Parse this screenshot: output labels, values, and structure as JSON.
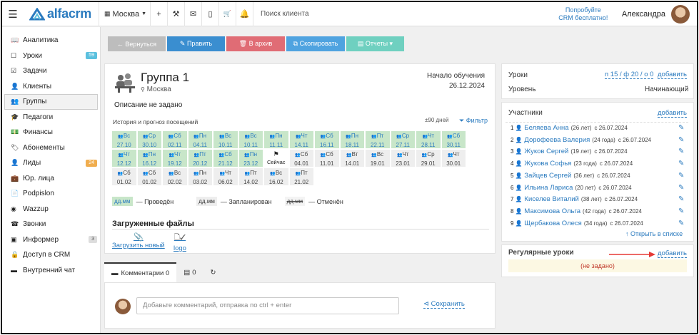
{
  "topbar": {
    "search_placeholder": "Поиск клиента",
    "branch": "Москва",
    "promo": [
      "Попробуйте",
      "CRM бесплатно!"
    ],
    "user_name": "Александра",
    "logo": "alfacrm"
  },
  "sidebar": {
    "items": [
      {
        "label": "Аналитика",
        "icon": "chart-icon"
      },
      {
        "label": "Уроки",
        "icon": "calendar-icon",
        "badge": "59",
        "badge_color": "#5bc0de"
      },
      {
        "label": "Задачи",
        "icon": "task-icon"
      },
      {
        "label": "Клиенты",
        "icon": "user-icon"
      },
      {
        "label": "Группы",
        "icon": "users-icon",
        "active": true
      },
      {
        "label": "Педагоги",
        "icon": "graduation-cap-icon"
      },
      {
        "label": "Финансы",
        "icon": "money-icon"
      },
      {
        "label": "Абонементы",
        "icon": "tag-icon"
      },
      {
        "label": "Лиды",
        "icon": "user-plus-icon",
        "badge": "24",
        "badge_color": "#f0ad4e"
      },
      {
        "label": "Юр. лица",
        "icon": "briefcase-icon"
      },
      {
        "label": "Podpislon",
        "icon": "document-icon"
      },
      {
        "label": "Wazzup",
        "icon": "whatsapp-icon"
      },
      {
        "label": "Звонки",
        "icon": "phone-icon"
      },
      {
        "label": "Информер",
        "icon": "informer-icon",
        "badge": "3",
        "badge_color": "#ddd"
      },
      {
        "label": "Доступ в CRM",
        "icon": "lock-icon"
      },
      {
        "label": "Внутренний чат",
        "icon": "chat-icon"
      }
    ]
  },
  "actions": {
    "back": "← Вернуться",
    "edit": "✎ Править",
    "archive": "🗑 В архив",
    "copy": "⧉ Скопировать",
    "reports": "▤ Отчеты ▾"
  },
  "group": {
    "title": "Группа 1",
    "location": "Москва",
    "start_label": "Начало обучения",
    "start_date": "26.12.2024",
    "description": "Описание не задано"
  },
  "history": {
    "title": "История и прогноз посещений",
    "days": "±90 дней",
    "filter": "Фильтр",
    "now_label": "Сейчас",
    "cells": [
      {
        "d": "Вс",
        "dt": "27.10",
        "s": "g"
      },
      {
        "d": "Ср",
        "dt": "30.10",
        "s": "g"
      },
      {
        "d": "Сб",
        "dt": "02.11",
        "s": "g"
      },
      {
        "d": "Пн",
        "dt": "04.11",
        "s": "g"
      },
      {
        "d": "Вс",
        "dt": "10.11",
        "s": "g"
      },
      {
        "d": "Вс",
        "dt": "10.11",
        "s": "g"
      },
      {
        "d": "Пн",
        "dt": "11.11",
        "s": "g"
      },
      {
        "d": "Чт",
        "dt": "14.11",
        "s": "g"
      },
      {
        "d": "Сб",
        "dt": "16.11",
        "s": "g"
      },
      {
        "d": "Пн",
        "dt": "18.11",
        "s": "g"
      },
      {
        "d": "Пт",
        "dt": "22.11",
        "s": "g"
      },
      {
        "d": "Ср",
        "dt": "27.11",
        "s": "g"
      },
      {
        "d": "Чт",
        "dt": "28.11",
        "s": "g"
      },
      {
        "d": "Сб",
        "dt": "30.11",
        "s": "g"
      },
      {
        "d": "Чт",
        "dt": "12.12",
        "s": "g"
      },
      {
        "d": "Пн",
        "dt": "16.12",
        "s": "g"
      },
      {
        "d": "Чт",
        "dt": "19.12",
        "s": "g"
      },
      {
        "d": "Пт",
        "dt": "20.12",
        "s": "g"
      },
      {
        "d": "Сб",
        "dt": "21.12",
        "s": "g"
      },
      {
        "d": "Пн",
        "dt": "23.12",
        "s": "g"
      },
      {
        "d": "",
        "dt": "Сейчас",
        "s": "now"
      },
      {
        "d": "Сб",
        "dt": "04.01",
        "s": "f"
      },
      {
        "d": "Сб",
        "dt": "11.01",
        "s": "f"
      },
      {
        "d": "Вт",
        "dt": "14.01",
        "s": "f"
      },
      {
        "d": "Вс",
        "dt": "19.01",
        "s": "f"
      },
      {
        "d": "Чт",
        "dt": "23.01",
        "s": "f"
      },
      {
        "d": "Ср",
        "dt": "29.01",
        "s": "f"
      },
      {
        "d": "Чт",
        "dt": "30.01",
        "s": "f"
      },
      {
        "d": "Сб",
        "dt": "01.02",
        "s": "f"
      },
      {
        "d": "Сб",
        "dt": "01.02",
        "s": "f"
      },
      {
        "d": "Вс",
        "dt": "02.02",
        "s": "f"
      },
      {
        "d": "Пн",
        "dt": "03.02",
        "s": "f"
      },
      {
        "d": "Чт",
        "dt": "06.02",
        "s": "f"
      },
      {
        "d": "Пт",
        "dt": "14.02",
        "s": "f"
      },
      {
        "d": "Вс",
        "dt": "16.02",
        "s": "f"
      },
      {
        "d": "Пт",
        "dt": "21.02",
        "s": "f"
      }
    ],
    "legend": [
      {
        "box": "дд.мм",
        "text": "— Проведён",
        "color": "#c8e6c9"
      },
      {
        "box": "дд.мм",
        "text": "— Запланирован",
        "color": "#eee"
      },
      {
        "box": "дд.мм",
        "text": "— Отменён",
        "color": "#fff"
      }
    ]
  },
  "files": {
    "title": "Загруженные файлы",
    "upload": "Загрузить новый",
    "file_name": "logo"
  },
  "comments": {
    "tab_comments": "Комментарии 0",
    "tab_docs": "0",
    "placeholder": "Добавьте комментарий, отправка по ctrl + enter",
    "save": "Сохранить"
  },
  "right": {
    "lessons_label": "Уроки",
    "lessons_stats": "п 15 / ф 20 / о 0",
    "add": "добавить",
    "level_label": "Уровень",
    "level_value": "Начинающий",
    "participants_label": "Участники",
    "members": [
      {
        "n": "1",
        "name": "Беляева Анна",
        "age": "(26 лет)",
        "since": "с 26.07.2024"
      },
      {
        "n": "2",
        "name": "Дорофеева Валерия",
        "age": "(24 года)",
        "since": "с 26.07.2024"
      },
      {
        "n": "3",
        "name": "Жуков Сергей",
        "age": "(19 лет)",
        "since": "с 26.07.2024"
      },
      {
        "n": "4",
        "name": "Жукова Софья",
        "age": "(23 года)",
        "since": "с 26.07.2024"
      },
      {
        "n": "5",
        "name": "Зайцев Сергей",
        "age": "(36 лет)",
        "since": "с 26.07.2024"
      },
      {
        "n": "6",
        "name": "Ильина Лариса",
        "age": "(20 лет)",
        "since": "с 26.07.2024"
      },
      {
        "n": "7",
        "name": "Киселев Виталий",
        "age": "(38 лет)",
        "since": "с 26.07.2024"
      },
      {
        "n": "8",
        "name": "Максимова Ольга",
        "age": "(42 года)",
        "since": "с 26.07.2024"
      },
      {
        "n": "9",
        "name": "Щербакова Олеся",
        "age": "(34 года)",
        "since": "с 26.07.2024"
      }
    ],
    "open_list": "↑ Открыть в списке",
    "regular_label": "Регулярные уроки",
    "not_set": "(не задано)"
  }
}
